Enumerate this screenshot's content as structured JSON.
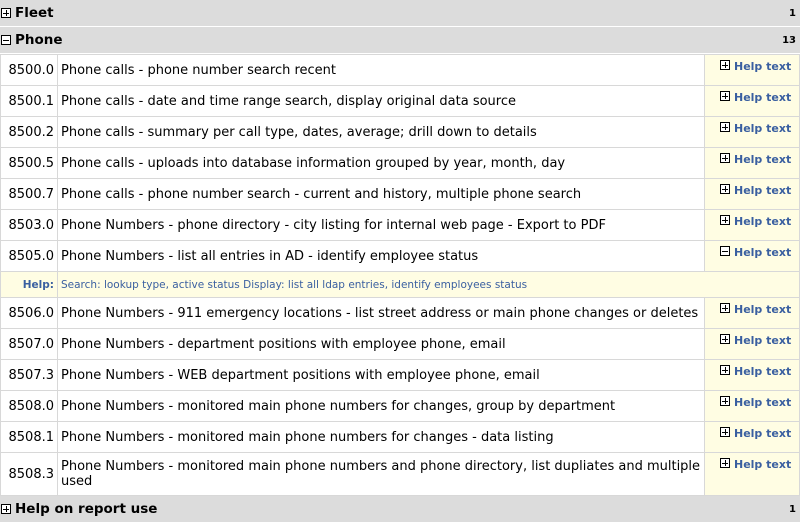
{
  "groups": [
    {
      "name": "Fleet",
      "count": "1",
      "expanded": false
    },
    {
      "name": "Phone",
      "count": "13",
      "expanded": true
    },
    {
      "name": "Help on report use",
      "count": "1",
      "expanded": false
    }
  ],
  "help_link": "Help text",
  "rows": [
    {
      "code": "8500.0",
      "desc": "Phone calls - phone number search recent"
    },
    {
      "code": "8500.1",
      "desc": "Phone calls - date and time range search, display original data source"
    },
    {
      "code": "8500.2",
      "desc": "Phone calls - summary per call type, dates, average; drill down to details"
    },
    {
      "code": "8500.5",
      "desc": "Phone calls - uploads into database information grouped by year, month, day"
    },
    {
      "code": "8500.7",
      "desc": "Phone calls - phone number search - current and history, multiple phone search"
    },
    {
      "code": "8503.0",
      "desc": "Phone Numbers - phone directory - city listing for internal web page - Export to PDF"
    },
    {
      "code": "8505.0",
      "desc": "Phone Numbers - list all entries in AD - identify employee status"
    },
    {
      "code": "8506.0",
      "desc": "Phone Numbers - 911 emergency locations - list street address or main phone changes or deletes"
    },
    {
      "code": "8507.0",
      "desc": "Phone Numbers - department positions with employee phone, email"
    },
    {
      "code": "8507.3",
      "desc": "Phone Numbers - WEB department positions with employee phone, email"
    },
    {
      "code": "8508.0",
      "desc": "Phone Numbers - monitored main phone numbers for changes, group by department"
    },
    {
      "code": "8508.1",
      "desc": "Phone Numbers - monitored main phone numbers for changes - data listing"
    },
    {
      "code": "8508.3",
      "desc": "Phone Numbers - monitored main phone numbers and phone directory, list dupliates and multiple used"
    }
  ],
  "expanded_help": {
    "label": "Help:",
    "text": "Search: lookup type, active status Display: list all ldap entries, identify employees status"
  }
}
